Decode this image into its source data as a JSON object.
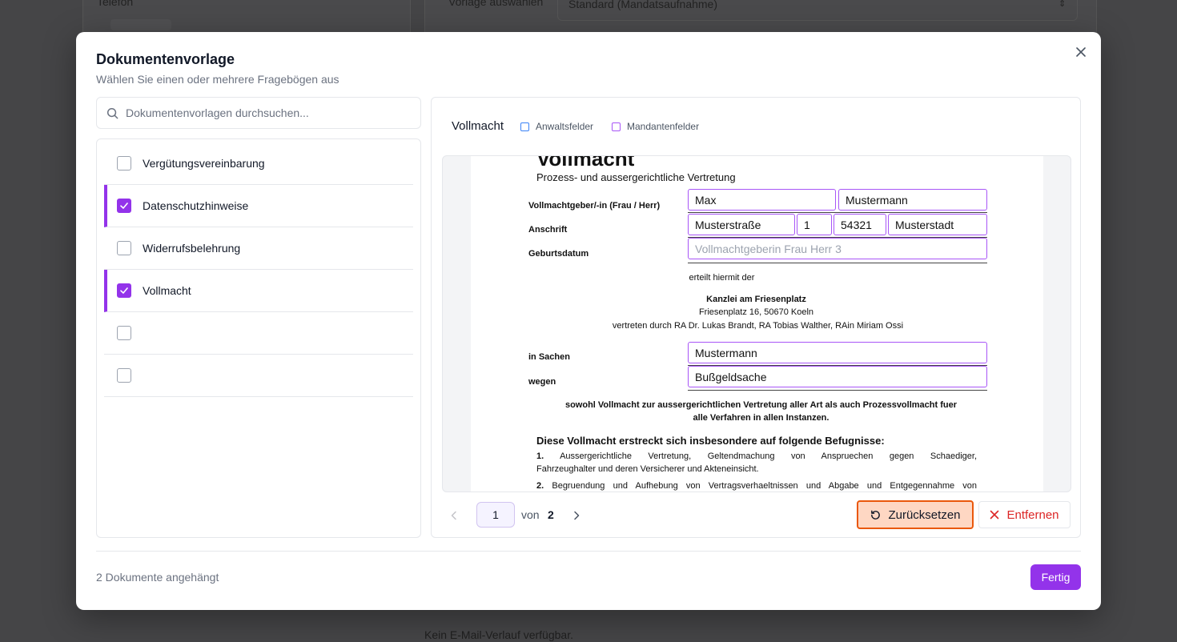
{
  "background": {
    "left_card_label": "Telefon",
    "right_card_label": "Vorlage auswählen",
    "template_select_value": "Standard (Mandatsaufnahme)",
    "footer_text": "Kein E-Mail-Verlauf verfügbar."
  },
  "modal": {
    "title": "Dokumentenvorlage",
    "subtitle": "Wählen Sie einen oder mehrere Fragebögen aus",
    "close_icon": "close-icon",
    "search": {
      "placeholder": "Dokumentenvorlagen durchsuchen...",
      "value": ""
    },
    "templates": [
      {
        "label": "Vergütungsvereinbarung",
        "checked": false
      },
      {
        "label": "Datenschutzhinweise",
        "checked": true
      },
      {
        "label": "Widerrufsbelehrung",
        "checked": false
      },
      {
        "label": "Vollmacht",
        "checked": true
      },
      {
        "label": "",
        "checked": false
      },
      {
        "label": "",
        "checked": false
      }
    ],
    "preview": {
      "title": "Vollmacht",
      "legend": [
        {
          "label": "Anwaltsfelder",
          "color": "#3b82f6"
        },
        {
          "label": "Mandantenfelder",
          "color": "#a855f7"
        }
      ],
      "document": {
        "heading": "Vollmacht",
        "subheading": "Prozess- und aussergerichtliche Vertretung",
        "label_grantor": "Vollmachtgeber/-in (Frau / Herr)",
        "label_address": "Anschrift",
        "label_birthdate": "Geburtsdatum",
        "field_first_name": "Max",
        "field_last_name": "Mustermann",
        "field_street": "Musterstraße",
        "field_house_number": "1",
        "field_zip": "54321",
        "field_city": "Musterstadt",
        "field_birthdate_placeholder": "Vollmachtgeberin Frau Herr 3",
        "granted_to_text": "erteilt hiermit der",
        "firm_name": "Kanzlei am Friesenplatz",
        "firm_address": "Friesenplatz 16, 50670 Koeln",
        "firm_represented": "vertreten durch RA Dr. Lukas Brandt, RA Tobias Walther, RAin Miriam Ossi",
        "label_matter": "in Sachen",
        "label_regarding": "wegen",
        "field_matter": "Mustermann",
        "field_regarding": "Bußgeldsache",
        "scope_line1": "sowohl Vollmacht zur aussergerichtlichen Vertretung aller Art als auch Prozessvollmacht fuer",
        "scope_line2": "alle Verfahren in allen Instanzen.",
        "powers_heading": "Diese Vollmacht erstreckt sich insbesondere auf folgende Befugnisse:",
        "power1_number": "1.",
        "power1_line1": "Aussergerichtliche Vertretung, Geltendmachung von Anspruechen gegen Schaediger,",
        "power1_line2": "Fahrzeughalter und deren Versicherer und Akteneinsicht.",
        "power2_number": "2.",
        "power2_line1": "Begruendung und Aufhebung von Vertragsverhaeltnissen und Abgabe und Entgegennahme von"
      },
      "pagination": {
        "current": "1",
        "of_label": "von",
        "total": "2"
      },
      "reset_label": "Zurücksetzen",
      "remove_label": "Entfernen"
    },
    "footer": {
      "attached_text": "2 Dokumente angehängt",
      "done_label": "Fertig"
    }
  },
  "colors": {
    "accent": "#9333ea",
    "danger": "#dc2626",
    "reset_border": "#ea580c",
    "reset_bg": "#fed7c3"
  }
}
